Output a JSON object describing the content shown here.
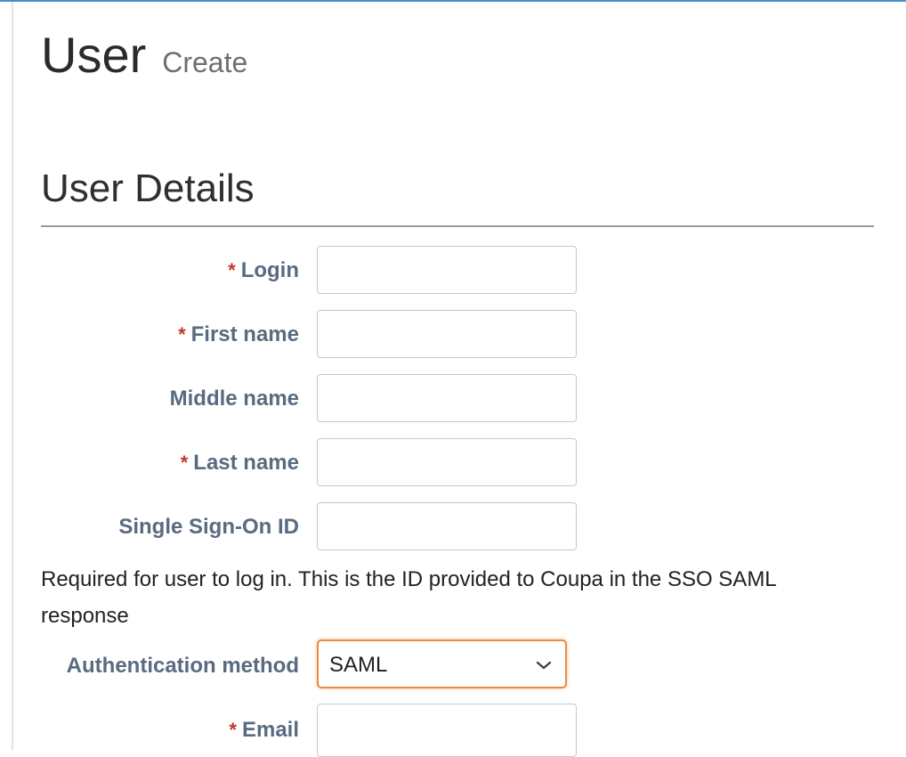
{
  "page": {
    "title": "User",
    "subtitle": "Create"
  },
  "section": {
    "title": "User Details"
  },
  "form": {
    "login_label": "Login",
    "login_required": "*",
    "first_name_label": "First name",
    "first_name_required": "*",
    "middle_name_label": "Middle name",
    "last_name_label": "Last name",
    "last_name_required": "*",
    "sso_id_label": "Single Sign-On ID",
    "sso_helper": "Required for user to log in. This is the ID provided to Coupa in the SSO SAML response",
    "auth_method_label": "Authentication method",
    "auth_method_value": "SAML",
    "email_label": "Email",
    "email_required": "*"
  },
  "colors": {
    "accent_focus": "#ef8a3e",
    "label": "#596b80",
    "required": "#c0392b",
    "top_border": "#4a90c9"
  }
}
